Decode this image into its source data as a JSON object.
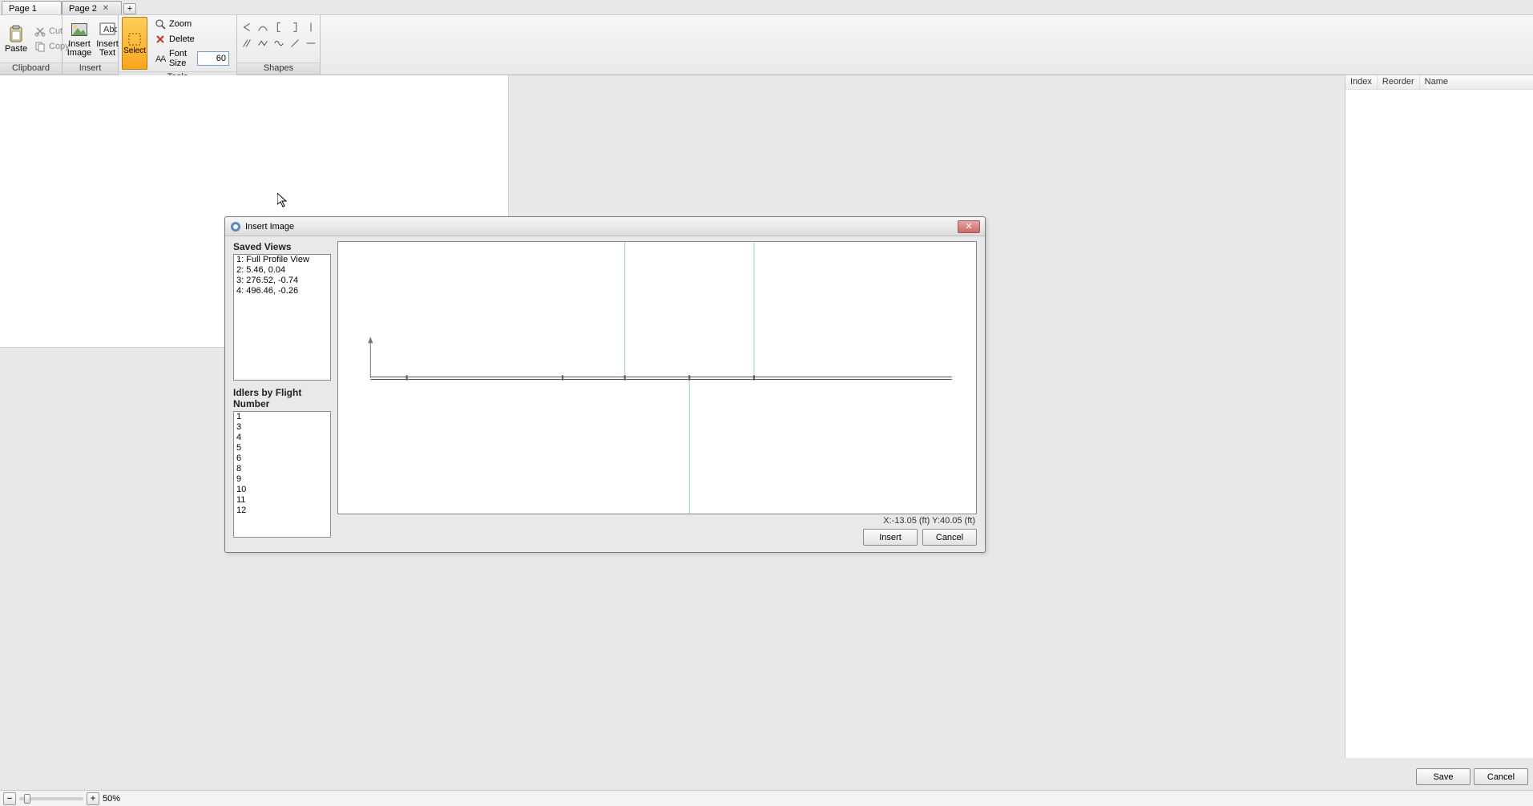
{
  "tabs": {
    "items": [
      {
        "label": "Page 1",
        "active": true,
        "closeable": false
      },
      {
        "label": "Page 2",
        "active": false,
        "closeable": true
      }
    ]
  },
  "ribbon": {
    "clipboard": {
      "label": "Clipboard",
      "paste": "Paste",
      "cut": "Cut",
      "copy": "Copy"
    },
    "insert": {
      "label": "Insert",
      "image": "Insert\nImage",
      "text": "Insert\nText"
    },
    "tools": {
      "label": "Tools",
      "select": "Select",
      "zoom": "Zoom",
      "del": "Delete",
      "fontsize_label": "Font Size",
      "fontsize_value": "60"
    },
    "shapes": {
      "label": "Shapes"
    }
  },
  "sidepanel": {
    "col_index": "Index",
    "col_reorder": "Reorder",
    "col_name": "Name"
  },
  "footer_buttons": {
    "save": "Save",
    "cancel": "Cancel"
  },
  "zoom": {
    "percent": "50%"
  },
  "dialog": {
    "title": "Insert Image",
    "saved_views_label": "Saved Views",
    "saved_views": [
      "1: Full Profile View",
      "2: 5.46, 0.04",
      "3: 276.52, -0.74",
      "4: 496.46, -0.26"
    ],
    "idlers_label": "Idlers by Flight Number",
    "idlers": [
      "1",
      "3",
      "4",
      "5",
      "6",
      "8",
      "9",
      "10",
      "11",
      "12"
    ],
    "coord_readout": "X:-13.05 (ft) Y:40.05 (ft)",
    "insert": "Insert",
    "cancel": "Cancel"
  }
}
